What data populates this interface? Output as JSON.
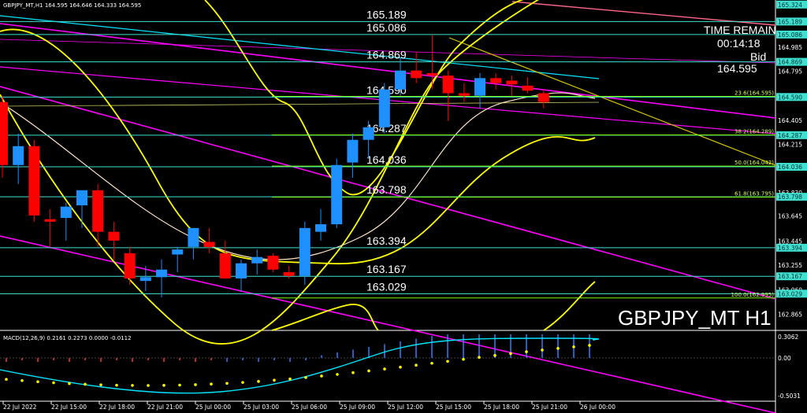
{
  "header": {
    "symbol_line": "GBPJPY_MT,H1  164.595 164.646 164.333 164.595"
  },
  "watermark": "GBPJPY_MT H1",
  "info_panel": {
    "time_label": "TIME REMAIN",
    "time_value": "00:14:18",
    "bid_label": "Bid",
    "bid_value": "164.595"
  },
  "macd": {
    "label": "MACD(12,26,9) 0.2161 0.2273 0.0000 -0.0112",
    "ticks": [
      "0.3062",
      "0.00",
      "-0.5031"
    ]
  },
  "colors": {
    "bull": "#1e90ff",
    "bear": "#ff0000",
    "band": "#ffff00",
    "ma_light": "#ffe4c4",
    "channel": "#ff00ff",
    "cyan": "#00e5ff",
    "level": "#40e0d0",
    "fib": "#7cfc00"
  },
  "chart_data": {
    "type": "candlestick",
    "ylim": [
      162.75,
      165.36
    ],
    "x_ticks": [
      "22 Jul 2022",
      "22 Jul 15:00",
      "22 Jul 18:00",
      "22 Jul 21:00",
      "25 Jul 00:00",
      "25 Jul 03:00",
      "25 Jul 06:00",
      "25 Jul 09:00",
      "25 Jul 12:00",
      "25 Jul 15:00",
      "25 Jul 18:00",
      "25 Jul 21:00",
      "26 Jul 00:00"
    ],
    "y_ticks": [
      "165.324",
      "165.189",
      "165.086",
      "164.985",
      "164.869",
      "164.795",
      "164.590",
      "164.405",
      "164.287",
      "164.215",
      "164.036",
      "163.830",
      "163.798",
      "163.645",
      "163.445",
      "163.394",
      "163.255",
      "163.167",
      "163.060",
      "163.029",
      "162.865"
    ],
    "highlight_ticks": [
      "165.324",
      "165.189",
      "165.086",
      "164.869",
      "164.590",
      "164.287",
      "164.036",
      "163.798",
      "163.394",
      "163.167",
      "163.029"
    ],
    "levels": [
      {
        "label": "165.189",
        "value": 165.189
      },
      {
        "label": "165.086",
        "value": 165.086
      },
      {
        "label": "164.869",
        "value": 164.869
      },
      {
        "label": "164.590",
        "value": 164.59
      },
      {
        "label": "164.287",
        "value": 164.287
      },
      {
        "label": "164.036",
        "value": 164.036
      },
      {
        "label": "163.798",
        "value": 163.798
      },
      {
        "label": "163.394",
        "value": 163.394
      },
      {
        "label": "163.167",
        "value": 163.167
      },
      {
        "label": "163.029",
        "value": 163.029
      }
    ],
    "fib_labels": [
      {
        "label": "23.6(164.595)",
        "value": 164.595
      },
      {
        "label": "38.2(164.289)",
        "value": 164.289
      },
      {
        "label": "50.0(164.042)",
        "value": 164.042
      },
      {
        "label": "61.8(163.795)",
        "value": 163.795
      },
      {
        "label": "100.0(162.995)",
        "value": 162.995
      }
    ],
    "candles": [
      {
        "o": 164.55,
        "h": 164.6,
        "l": 163.95,
        "c": 164.05
      },
      {
        "o": 164.05,
        "h": 164.3,
        "l": 163.9,
        "c": 164.2
      },
      {
        "o": 164.2,
        "h": 164.25,
        "l": 163.6,
        "c": 163.65
      },
      {
        "o": 163.62,
        "h": 163.7,
        "l": 163.4,
        "c": 163.6
      },
      {
        "o": 163.63,
        "h": 163.75,
        "l": 163.45,
        "c": 163.72
      },
      {
        "o": 163.73,
        "h": 163.85,
        "l": 163.55,
        "c": 163.85
      },
      {
        "o": 163.85,
        "h": 163.9,
        "l": 163.4,
        "c": 163.52
      },
      {
        "o": 163.52,
        "h": 163.6,
        "l": 163.3,
        "c": 163.45
      },
      {
        "o": 163.35,
        "h": 163.4,
        "l": 163.1,
        "c": 163.15
      },
      {
        "o": 163.13,
        "h": 163.25,
        "l": 163.05,
        "c": 163.16
      },
      {
        "o": 163.16,
        "h": 163.3,
        "l": 163.0,
        "c": 163.22
      },
      {
        "o": 163.34,
        "h": 163.4,
        "l": 163.2,
        "c": 163.38
      },
      {
        "o": 163.4,
        "h": 163.55,
        "l": 163.3,
        "c": 163.55
      },
      {
        "o": 163.44,
        "h": 163.55,
        "l": 163.35,
        "c": 163.4
      },
      {
        "o": 163.35,
        "h": 163.45,
        "l": 163.15,
        "c": 163.15
      },
      {
        "o": 163.15,
        "h": 163.3,
        "l": 163.05,
        "c": 163.27
      },
      {
        "o": 163.27,
        "h": 163.38,
        "l": 163.18,
        "c": 163.32
      },
      {
        "o": 163.33,
        "h": 163.35,
        "l": 163.2,
        "c": 163.22
      },
      {
        "o": 163.2,
        "h": 163.25,
        "l": 163.15,
        "c": 163.17
      },
      {
        "o": 163.17,
        "h": 163.6,
        "l": 163.1,
        "c": 163.55
      },
      {
        "o": 163.52,
        "h": 163.7,
        "l": 163.45,
        "c": 163.58
      },
      {
        "o": 163.58,
        "h": 164.1,
        "l": 163.55,
        "c": 164.05
      },
      {
        "o": 164.07,
        "h": 164.3,
        "l": 163.95,
        "c": 164.25
      },
      {
        "o": 164.25,
        "h": 164.4,
        "l": 164.1,
        "c": 164.35
      },
      {
        "o": 164.35,
        "h": 164.7,
        "l": 164.3,
        "c": 164.65
      },
      {
        "o": 164.65,
        "h": 164.9,
        "l": 164.6,
        "c": 164.8
      },
      {
        "o": 164.8,
        "h": 164.95,
        "l": 164.7,
        "c": 164.74
      },
      {
        "o": 164.78,
        "h": 165.08,
        "l": 164.65,
        "c": 164.76
      },
      {
        "o": 164.76,
        "h": 164.8,
        "l": 164.4,
        "c": 164.62
      },
      {
        "o": 164.62,
        "h": 164.7,
        "l": 164.55,
        "c": 164.6
      },
      {
        "o": 164.6,
        "h": 164.78,
        "l": 164.5,
        "c": 164.74
      },
      {
        "o": 164.74,
        "h": 164.78,
        "l": 164.65,
        "c": 164.7
      },
      {
        "o": 164.72,
        "h": 164.76,
        "l": 164.6,
        "c": 164.69
      },
      {
        "o": 164.68,
        "h": 164.75,
        "l": 164.62,
        "c": 164.64
      },
      {
        "o": 164.62,
        "h": 164.65,
        "l": 164.5,
        "c": 164.55
      }
    ]
  }
}
